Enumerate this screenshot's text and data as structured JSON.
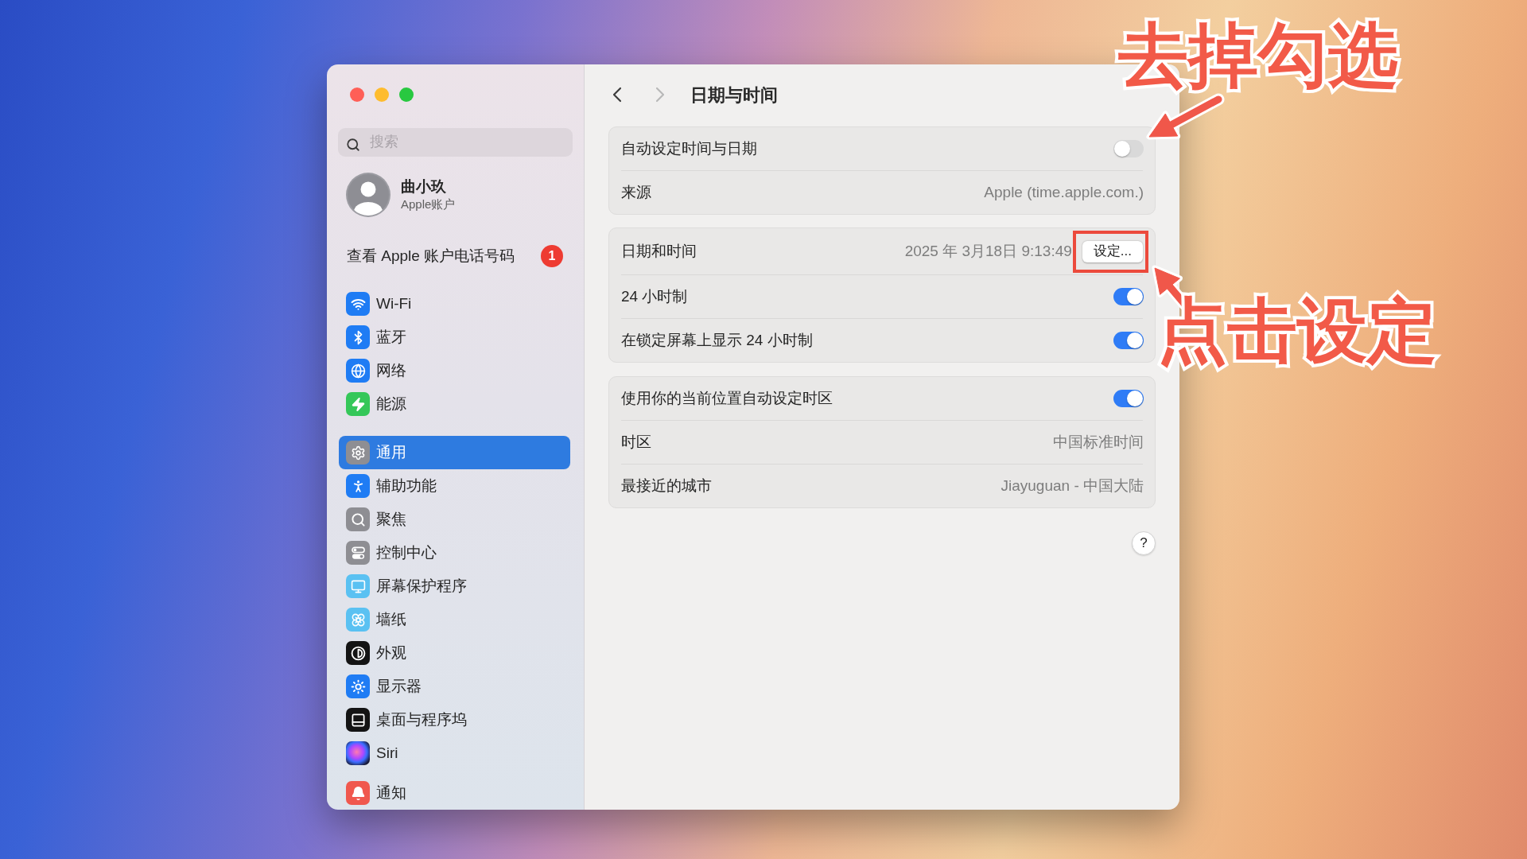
{
  "sidebar": {
    "search": {
      "placeholder": "搜索"
    },
    "account": {
      "name": "曲小玖",
      "subtitle": "Apple账户"
    },
    "notice": {
      "label": "查看 Apple 账户电话号码",
      "badge": "1"
    },
    "groups": [
      {
        "items": [
          {
            "label": "Wi-Fi",
            "selected": false
          },
          {
            "label": "蓝牙",
            "selected": false
          },
          {
            "label": "网络",
            "selected": false
          },
          {
            "label": "能源",
            "selected": false
          }
        ]
      },
      {
        "items": [
          {
            "label": "通用",
            "selected": true
          },
          {
            "label": "辅助功能",
            "selected": false
          },
          {
            "label": "聚焦",
            "selected": false
          },
          {
            "label": "控制中心",
            "selected": false
          },
          {
            "label": "屏幕保护程序",
            "selected": false
          },
          {
            "label": "墙纸",
            "selected": false
          },
          {
            "label": "外观",
            "selected": false
          },
          {
            "label": "显示器",
            "selected": false
          },
          {
            "label": "桌面与程序坞",
            "selected": false
          },
          {
            "label": "Siri",
            "selected": false
          }
        ]
      },
      {
        "items": [
          {
            "label": "通知",
            "selected": false
          }
        ]
      }
    ]
  },
  "content": {
    "nav": {
      "back": {
        "disabled": false
      },
      "forward": {
        "disabled": true
      }
    },
    "title": "日期与时间",
    "groups": [
      {
        "rows": [
          {
            "kind": "toggle",
            "label": "自动设定时间与日期",
            "on": false
          },
          {
            "kind": "value",
            "label": "来源",
            "value": "Apple (time.apple.com.)"
          }
        ]
      },
      {
        "rows": [
          {
            "kind": "value_button",
            "label": "日期和时间",
            "value": "2025 年 3月18日 9:13:49",
            "button": "设定...",
            "highlighted": true
          },
          {
            "kind": "toggle",
            "label": "24 小时制",
            "on": true
          },
          {
            "kind": "toggle",
            "label": "在锁定屏幕上显示 24 小时制",
            "on": true
          }
        ]
      },
      {
        "rows": [
          {
            "kind": "toggle",
            "label": "使用你的当前位置自动设定时区",
            "on": true
          },
          {
            "kind": "value",
            "label": "时区",
            "value": "中国标准时间"
          },
          {
            "kind": "value",
            "label": "最接近的城市",
            "value": "Jiayuguan - 中国大陆"
          }
        ]
      }
    ],
    "help": "?"
  },
  "annotations": {
    "callouts": [
      "去掉勾选",
      "点击设定"
    ]
  }
}
